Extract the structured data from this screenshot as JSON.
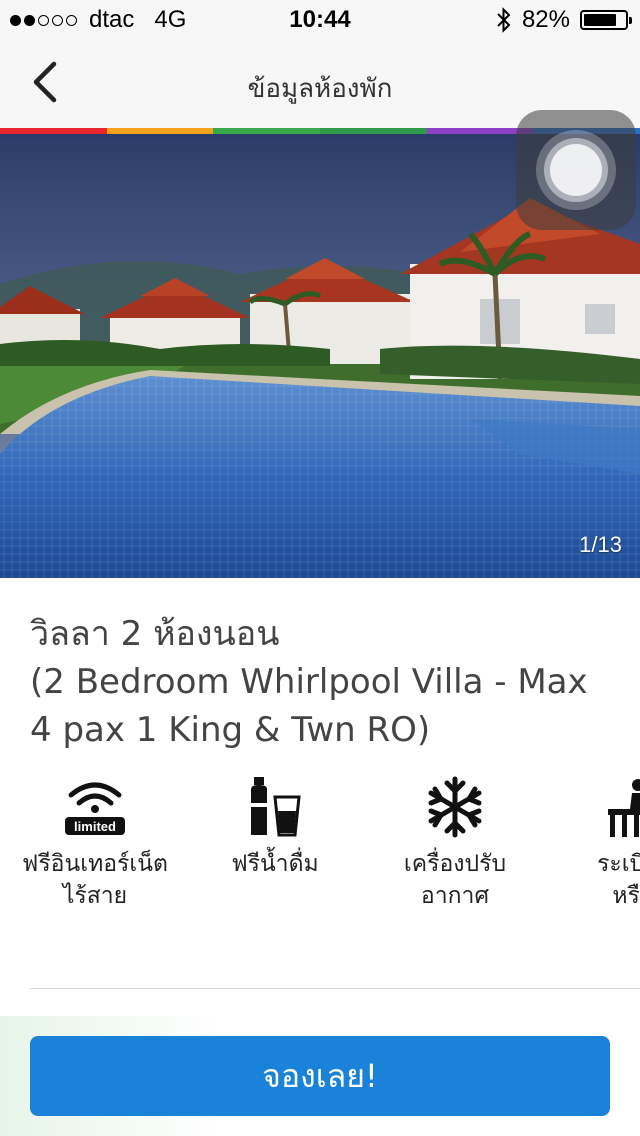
{
  "status_bar": {
    "carrier": "dtac",
    "network": "4G",
    "time": "10:44",
    "battery_text": "82%",
    "battery_level": 0.82,
    "signal_bars_filled": 2,
    "signal_bars_total": 5
  },
  "nav": {
    "title": "ข้อมูลห้องพัก",
    "back_icon": "chevron-left-icon"
  },
  "accent_colors": [
    "#e8262d",
    "#f4a11d",
    "#37a94a",
    "#2f9b49",
    "#8d3fc6",
    "#2a72c9"
  ],
  "gallery": {
    "counter": "1/13"
  },
  "room": {
    "title_line": "วิลลา 2 ห้องนอน",
    "subtitle": "(2 Bedroom Whirlpool Villa - Max 4 pax 1 King & Twn RO)"
  },
  "amenities": [
    {
      "icon": "wifi-limited-icon",
      "badge": "limited",
      "label_line1": "ฟรีอินเทอร์เน็ต",
      "label_line2": "ไร้สาย"
    },
    {
      "icon": "drinking-water-icon",
      "label_line1": "ฟรีน้ำดื่ม",
      "label_line2": ""
    },
    {
      "icon": "snowflake-icon",
      "label_line1": "เครื่องปรับ",
      "label_line2": "อากาศ"
    },
    {
      "icon": "balcony-icon",
      "label_line1": "ระเบียง",
      "label_line2": "หรือ"
    }
  ],
  "cta": {
    "label": "จองเลย!",
    "color": "#1a82d9"
  }
}
